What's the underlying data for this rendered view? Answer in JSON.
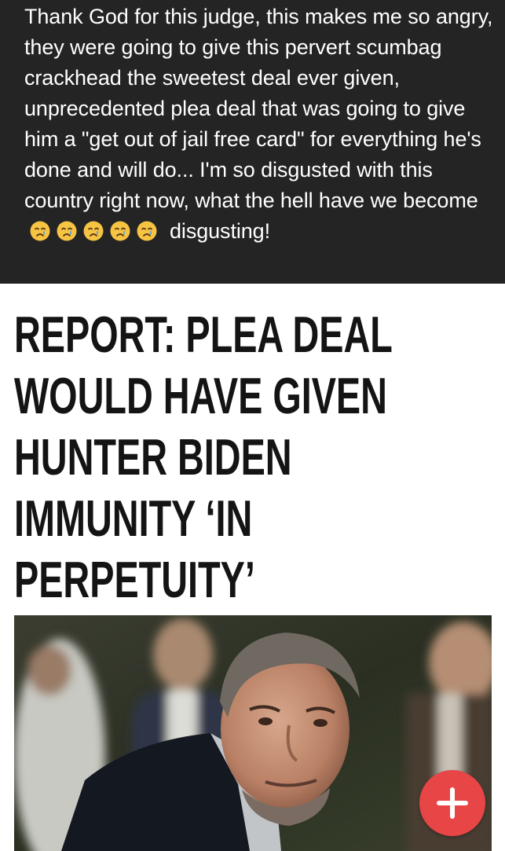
{
  "post": {
    "text": "Thank God for this judge, this makes me so angry, they were going to give this pervert scumbag crackhead the sweetest deal ever given, unprecedented plea deal that was going to give him a \"get out of jail free card\" for everything  he's done and will do... I'm so disgusted with this country right now, what the hell have we become",
    "emojis": [
      "crying-face-emoji",
      "crying-face-emoji",
      "crying-face-emoji",
      "crying-face-emoji",
      "crying-face-emoji"
    ],
    "text_after_emojis": "disgusting!"
  },
  "article": {
    "headline_lines": [
      "REPORT: PLEA DEAL",
      "WOULD HAVE GIVEN",
      "HUNTER BIDEN",
      "IMMUNITY ‘IN",
      "PERPETUITY’"
    ]
  },
  "fab": {
    "icon": "plus-icon",
    "color": "#e74546"
  },
  "colors": {
    "post_background": "#242424",
    "post_text": "#ffffff",
    "headline_text": "#141414"
  }
}
